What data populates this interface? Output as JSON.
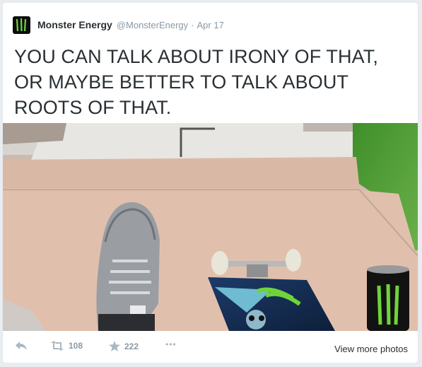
{
  "header": {
    "display_name": "Monster Energy",
    "handle": "@MonsterEnergy",
    "separator": "·",
    "date": "Apr 17"
  },
  "tweet": {
    "line1": "YOU CAN TALK ABOUT IRONY OF THAT,",
    "line2": "OR MAYBE BETTER TO TALK ABOUT",
    "line3": "ROOTS OF THAT."
  },
  "actions": {
    "retweet_count": "108",
    "favorite_count": "222",
    "more_label": "•••",
    "view_more_label": "View more photos"
  },
  "icons": {
    "reply": "reply-arrow-icon",
    "retweet": "retweet-icon",
    "favorite": "star-icon",
    "more": "more-dots-icon",
    "avatar": "monster-claw-logo"
  },
  "colors": {
    "text": "#292f33",
    "muted": "#8899a6",
    "icon": "#aab8c2",
    "brand_green": "#6fd43a"
  }
}
